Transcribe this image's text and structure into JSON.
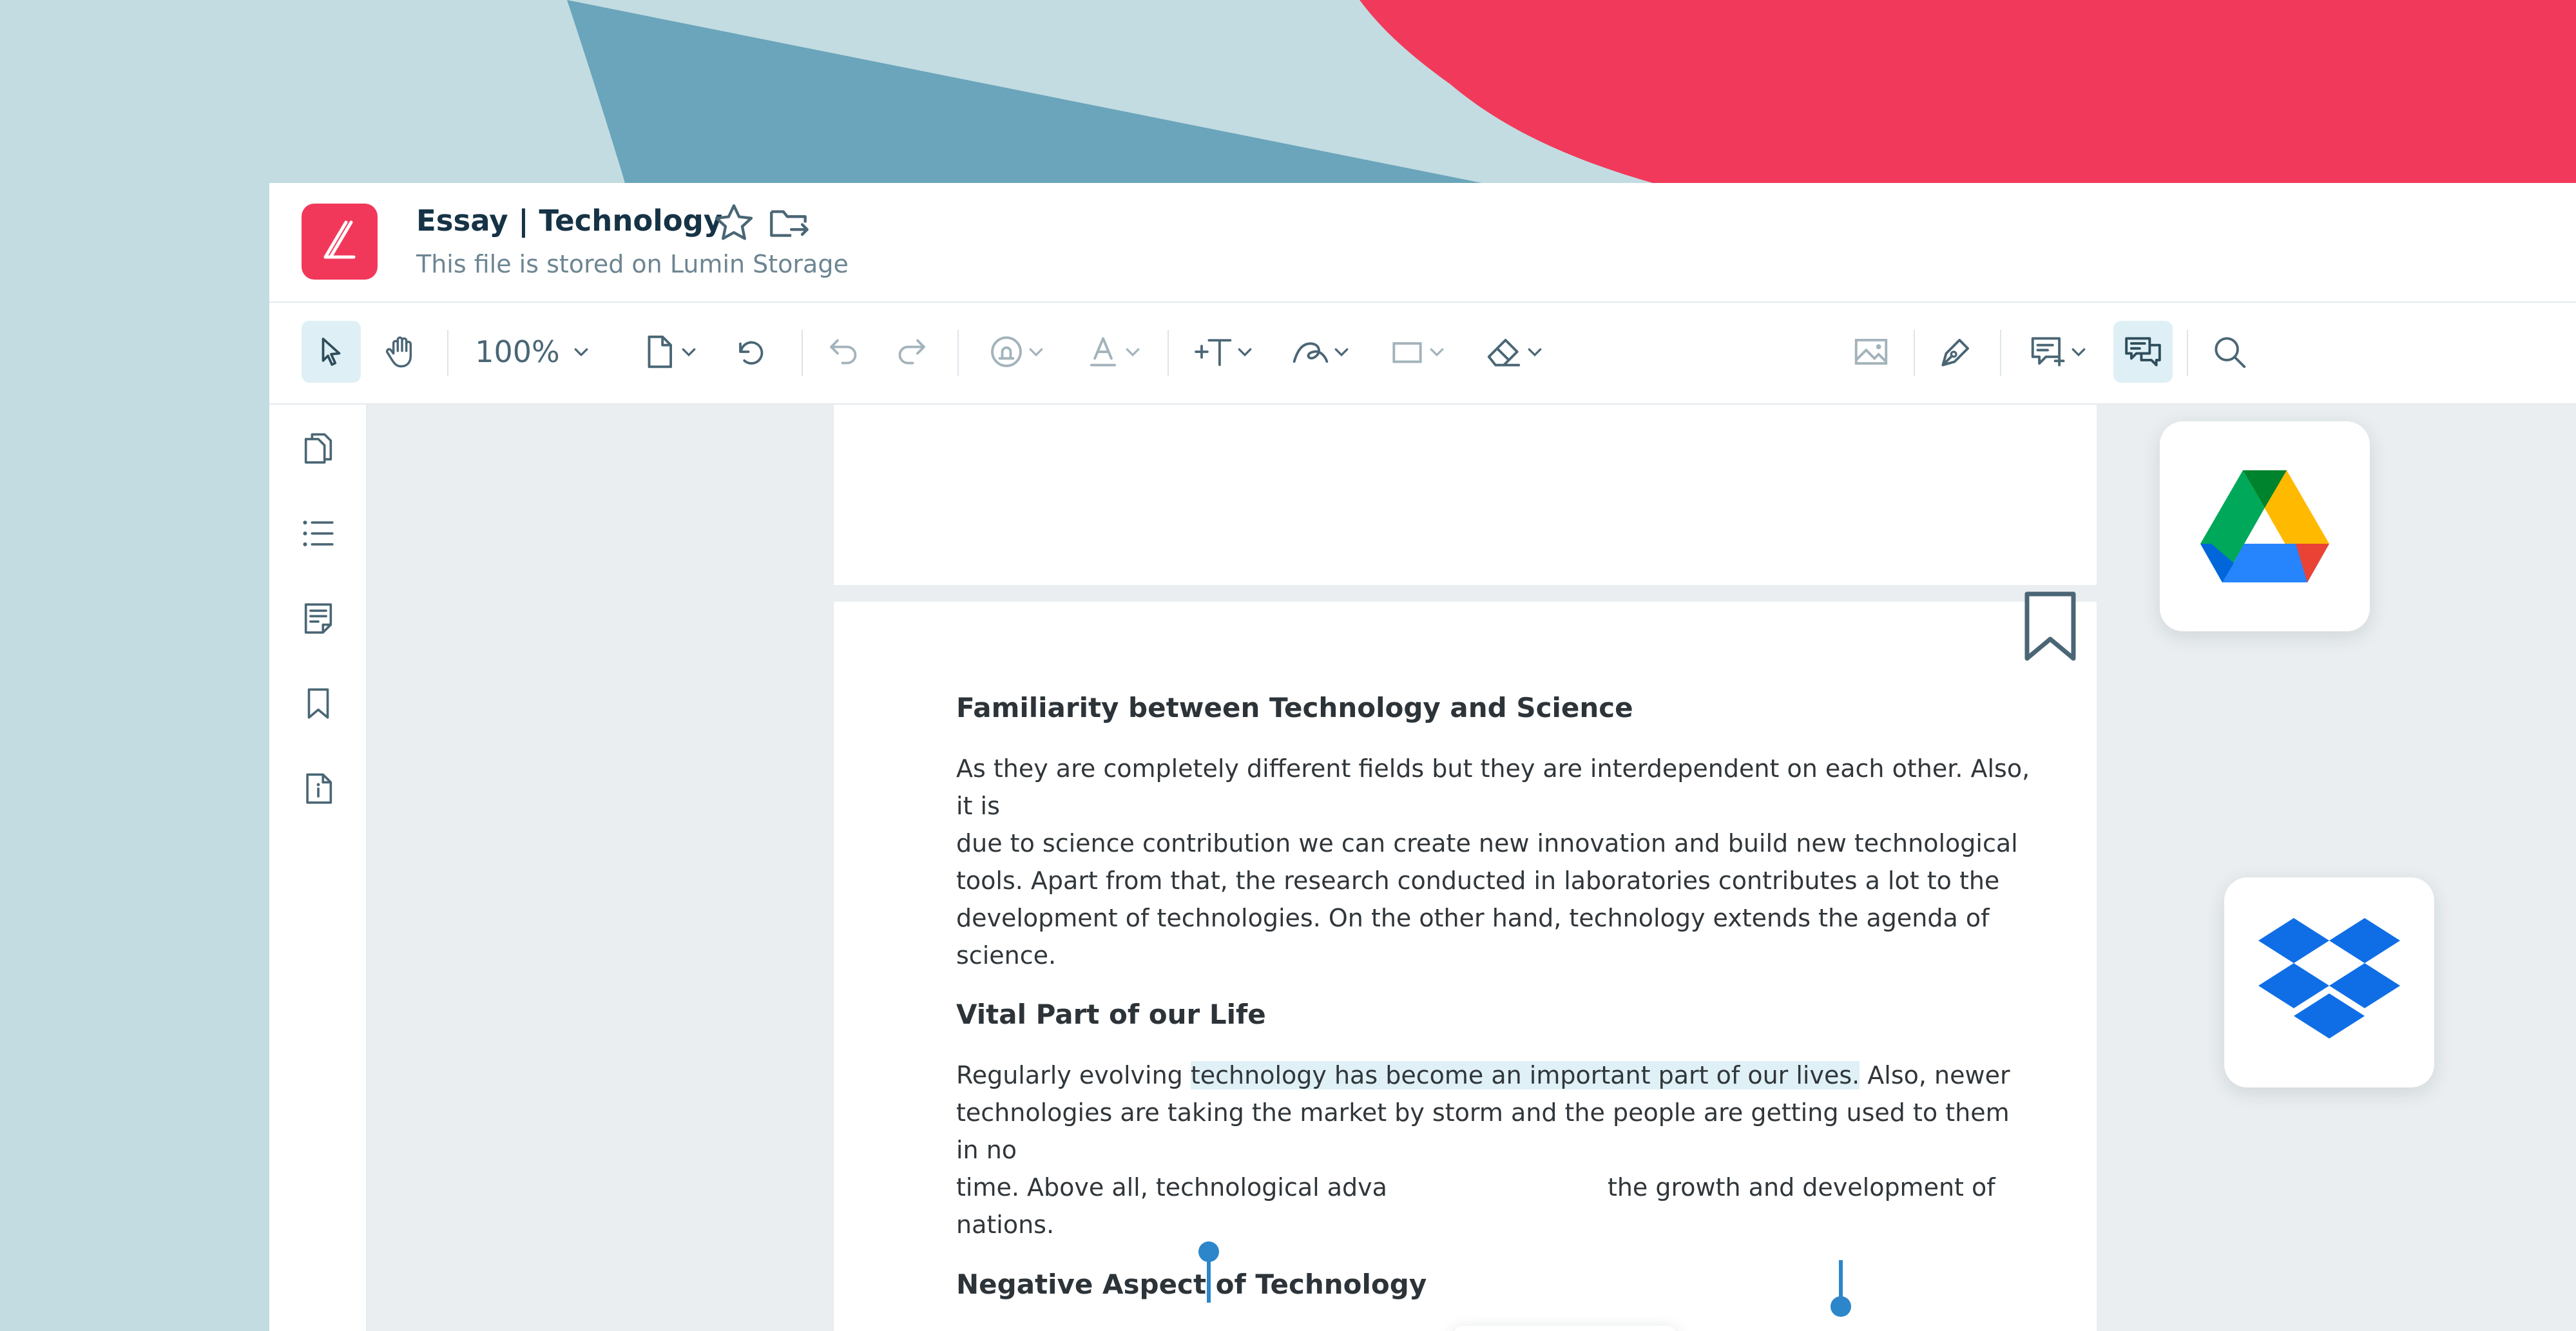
{
  "colors": {
    "brand": "#f1385a",
    "accent_blue": "#2c86c9",
    "bg_light": "#c3dce2",
    "bg_mid": "#6aa5bb",
    "selection": "#dff0f6"
  },
  "header": {
    "title": "Essay | Technology",
    "subtitle": "This file is stored on Lumin Storage",
    "icons": [
      "star-icon",
      "move-folder-icon"
    ]
  },
  "toolbar": {
    "zoom": "100%",
    "tools": [
      "select-tool",
      "pan-tool",
      "zoom-dropdown",
      "page-tool",
      "rotate",
      "undo",
      "redo",
      "stamp-tool",
      "text-color-tool",
      "add-text-tool",
      "freehand-tool",
      "shape-tool",
      "eraser-tool",
      "image-tool",
      "sign-tool",
      "comment-tool",
      "comments-panel",
      "search"
    ]
  },
  "sidebar": {
    "items": [
      "pages-icon",
      "outline-icon",
      "notes-icon",
      "bookmark-icon",
      "file-info-icon"
    ]
  },
  "document": {
    "sections": [
      {
        "heading": "Familiarity between Technology and Science",
        "lines": [
          "As they are completely different fields but they are interdependent on each other. Also, it is",
          "due to science contribution we can create new innovation and build new technological",
          "tools. Apart from that, the research conducted in laboratories contributes a lot to the",
          "development of technologies. On the other hand, technology extends the agenda of",
          "science."
        ]
      },
      {
        "heading": "Vital Part of our Life",
        "line1_before": "Regularly evolving ",
        "line1_selected": "technology has become an important part of our lives.",
        "line1_after": " Also, newer",
        "line2": "technologies are taking the market by storm and the people are getting used to them in no",
        "line3_before": "time. Above all, technological adva",
        "line3_after": "the growth and development of",
        "line4": "nations."
      },
      {
        "heading": "Negative Aspect of Technology"
      }
    ]
  },
  "selection_popup": [
    "add-comment-icon",
    "copy-icon",
    "link-icon"
  ],
  "integrations": [
    "Google Drive",
    "Dropbox"
  ]
}
